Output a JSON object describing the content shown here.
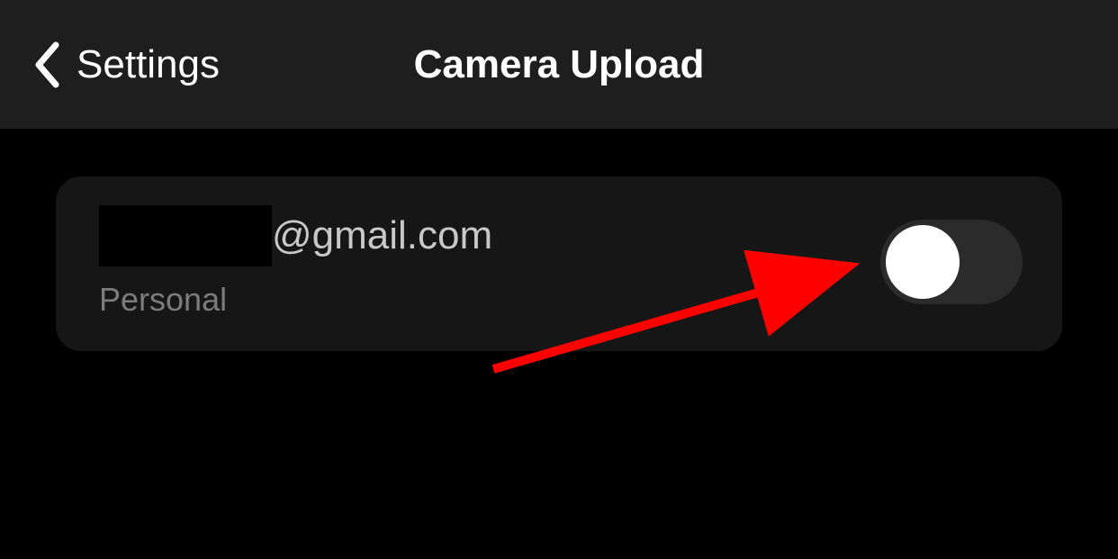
{
  "header": {
    "back_label": "Settings",
    "title": "Camera Upload"
  },
  "account": {
    "email_domain": "@gmail.com",
    "type_label": "Personal",
    "toggle_state": "off"
  }
}
